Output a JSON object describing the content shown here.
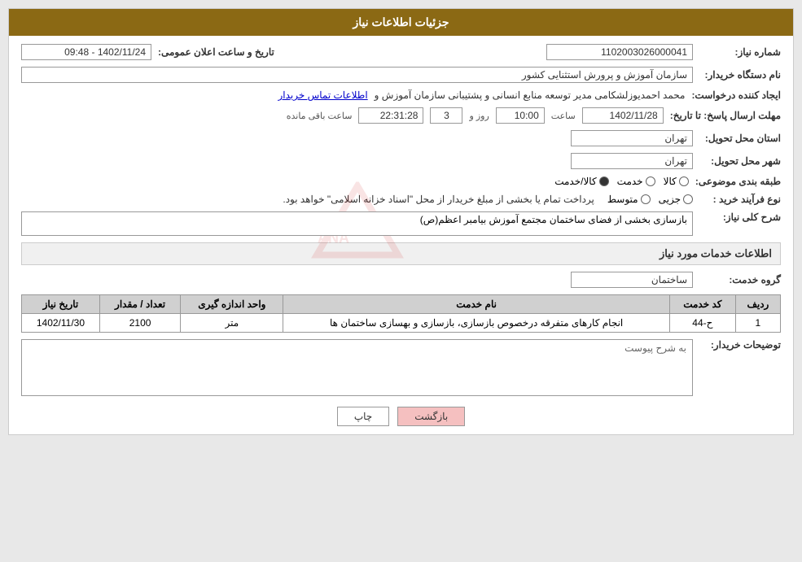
{
  "header": {
    "title": "جزئیات اطلاعات نیاز"
  },
  "fields": {
    "need_number_label": "شماره نیاز:",
    "need_number_value": "1102003026000041",
    "announce_date_label": "تاریخ و ساعت اعلان عمومی:",
    "announce_date_value": "1402/11/24 - 09:48",
    "org_name_label": "نام دستگاه خریدار:",
    "org_name_value": "سازمان آموزش و پرورش استثنایی کشور",
    "creator_label": "ایجاد کننده درخواست:",
    "creator_value": "محمد احمدیوزلشکامی مدیر توسعه منابع انسانی و پشتیبانی سازمان آموزش و",
    "creator_link": "اطلاعات تماس خریدار",
    "deadline_label": "مهلت ارسال پاسخ: تا تاریخ:",
    "deadline_date": "1402/11/28",
    "deadline_time_label": "ساعت",
    "deadline_time": "10:00",
    "deadline_day_label": "روز و",
    "deadline_days": "3",
    "deadline_remaining_label": "ساعت باقی مانده",
    "deadline_remaining": "22:31:28",
    "province_label": "استان محل تحویل:",
    "province_value": "تهران",
    "city_label": "شهر محل تحویل:",
    "city_value": "تهران",
    "category_label": "طبقه بندی موضوعی:",
    "category_options": [
      "کالا",
      "خدمت",
      "کالا/خدمت"
    ],
    "category_selected": "کالا/خدمت",
    "process_label": "نوع فرآیند خرید :",
    "process_options": [
      "جزیی",
      "متوسط"
    ],
    "process_description": "پرداخت تمام یا بخشی از مبلغ خریدار از محل \"اسناد خزانه اسلامی\" خواهد بود.",
    "need_desc_label": "شرح کلی نیاز:",
    "need_desc_value": "بازسازی بخشی از فضای ساختمان مجتمع آموزش بیامبر اعظم(ص)",
    "services_section_label": "اطلاعات خدمات مورد نیاز",
    "service_group_label": "گروه خدمت:",
    "service_group_value": "ساختمان",
    "table_headers": {
      "row_num": "ردیف",
      "service_code": "کد خدمت",
      "service_name": "نام خدمت",
      "unit": "واحد اندازه گیری",
      "quantity": "تعداد / مقدار",
      "date": "تاریخ نیاز"
    },
    "table_rows": [
      {
        "row_num": "1",
        "service_code": "ح-44",
        "service_name": "انجام کارهای متفرقه درخصوص بازسازی، بازسازی و بهسازی ساختمان ها",
        "unit": "متر",
        "quantity": "2100",
        "date": "1402/11/30"
      }
    ],
    "buyer_notes_label": "توضیحات خریدار:",
    "buyer_notes_placeholder": "به شرح پیوست"
  },
  "buttons": {
    "print_label": "چاپ",
    "back_label": "بازگشت"
  }
}
